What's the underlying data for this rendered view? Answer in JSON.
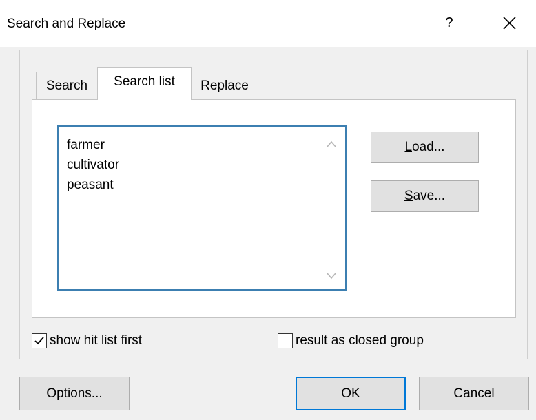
{
  "window": {
    "title": "Search and Replace",
    "help_label": "?"
  },
  "tabs": [
    {
      "label": "Search",
      "active": false
    },
    {
      "label": "Search list",
      "active": true
    },
    {
      "label": "Replace",
      "active": false
    }
  ],
  "search_list": {
    "items": [
      "farmer",
      "cultivator",
      "peasant"
    ]
  },
  "side_buttons": {
    "load": {
      "mnemonic": "L",
      "rest": "oad..."
    },
    "save": {
      "mnemonic": "S",
      "rest": "ave..."
    }
  },
  "checkboxes": {
    "show_hit_list": {
      "label": "show hit list first",
      "checked": true
    },
    "closed_group": {
      "label": "result as closed group",
      "checked": false
    }
  },
  "footer": {
    "options_label": "Options...",
    "ok_label": "OK",
    "cancel_label": "Cancel"
  },
  "colors": {
    "focus_border": "#3c7fb1",
    "button_face": "#e1e1e1",
    "dialog_bg": "#f0f0f0"
  }
}
